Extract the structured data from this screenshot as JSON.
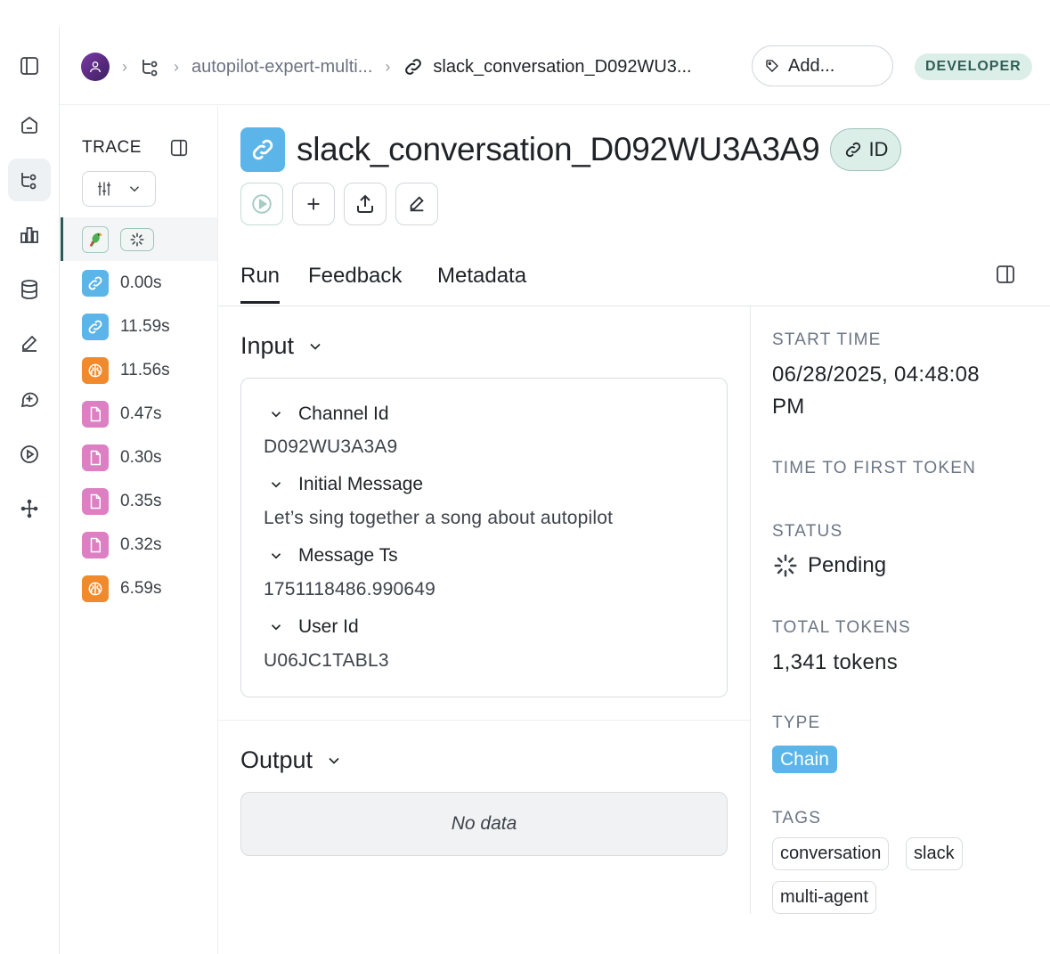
{
  "breadcrumb": {
    "project": "autopilot-expert-multi...",
    "run": "slack_conversation_D092WU3...",
    "add_tag_label": "Add...",
    "badge": "DEVELOPER"
  },
  "trace": {
    "title": "TRACE",
    "rows": [
      {
        "kind": "chain",
        "duration": "0.00s"
      },
      {
        "kind": "chain",
        "duration": "11.59s"
      },
      {
        "kind": "llm",
        "duration": "11.56s"
      },
      {
        "kind": "doc",
        "duration": "0.47s"
      },
      {
        "kind": "doc",
        "duration": "0.30s"
      },
      {
        "kind": "doc",
        "duration": "0.35s"
      },
      {
        "kind": "doc",
        "duration": "0.32s"
      },
      {
        "kind": "llm",
        "duration": "6.59s"
      }
    ]
  },
  "run": {
    "title": "slack_conversation_D092WU3A3A9",
    "id_label": "ID"
  },
  "tabs": [
    "Run",
    "Feedback",
    "Metadata"
  ],
  "input": {
    "title": "Input",
    "fields": [
      {
        "key": "Channel Id",
        "value": "D092WU3A3A9"
      },
      {
        "key": "Initial Message",
        "value": "Let’s sing together a song about autopilot"
      },
      {
        "key": "Message Ts",
        "value": "1751118486.990649"
      },
      {
        "key": "User Id",
        "value": "U06JC1TABL3"
      }
    ]
  },
  "output": {
    "title": "Output",
    "empty_text": "No data"
  },
  "details": {
    "start_time_label": "START TIME",
    "start_time_line1": "06/28/2025, 04:48:08",
    "start_time_line2": "PM",
    "ttft_label": "TIME TO FIRST TOKEN",
    "status_label": "STATUS",
    "status_value": "Pending",
    "total_tokens_label": "TOTAL TOKENS",
    "total_tokens_value": "1,341 tokens",
    "type_label": "TYPE",
    "type_value": "Chain",
    "tags_label": "TAGS",
    "tags": [
      "conversation",
      "slack",
      "multi-agent"
    ]
  },
  "colors": {
    "chain": "#5bb5e8",
    "llm": "#f08a2c",
    "doc": "#dc7fc3",
    "accent": "#2d5a57"
  }
}
